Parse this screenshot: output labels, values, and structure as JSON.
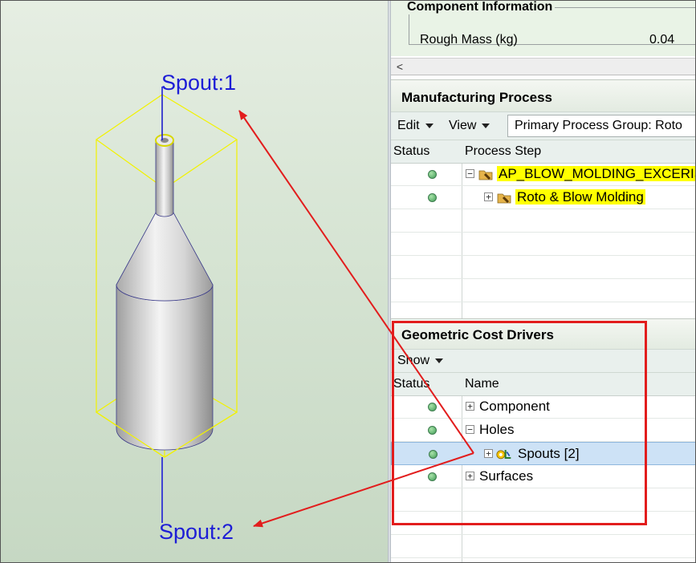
{
  "viewport": {
    "spout1_label": "Spout:1",
    "spout2_label": "Spout:2"
  },
  "component_info": {
    "title": "Component Information",
    "rough_mass_label": "Rough Mass (kg)",
    "rough_mass_value": "0.04",
    "scroll_left": "<"
  },
  "manufacturing_process": {
    "title": "Manufacturing Process",
    "edit_menu": "Edit",
    "view_menu": "View",
    "process_group": "Primary Process Group: Roto",
    "columns": {
      "status": "Status",
      "process_step": "Process Step"
    },
    "rows": [
      {
        "expander": "−",
        "label": "AP_BLOW_MOLDING_EXCERISE"
      },
      {
        "expander": "+",
        "label": "Roto & Blow Molding"
      }
    ]
  },
  "geometric_cost_drivers": {
    "title": "Geometric Cost Drivers",
    "show_menu": "Show",
    "columns": {
      "status": "Status",
      "name": "Name"
    },
    "rows": [
      {
        "expander": "+",
        "label": "Component"
      },
      {
        "expander": "−",
        "label": "Holes"
      },
      {
        "expander": "+",
        "label": "Spouts [2]"
      },
      {
        "expander": "+",
        "label": "Surfaces"
      }
    ]
  },
  "colors": {
    "highlight": "#ffff00",
    "annotation": "#e21d1d",
    "spout_label": "#1d1dd6",
    "status_ok": "#3e9b55",
    "selection": "#cde2f6"
  }
}
